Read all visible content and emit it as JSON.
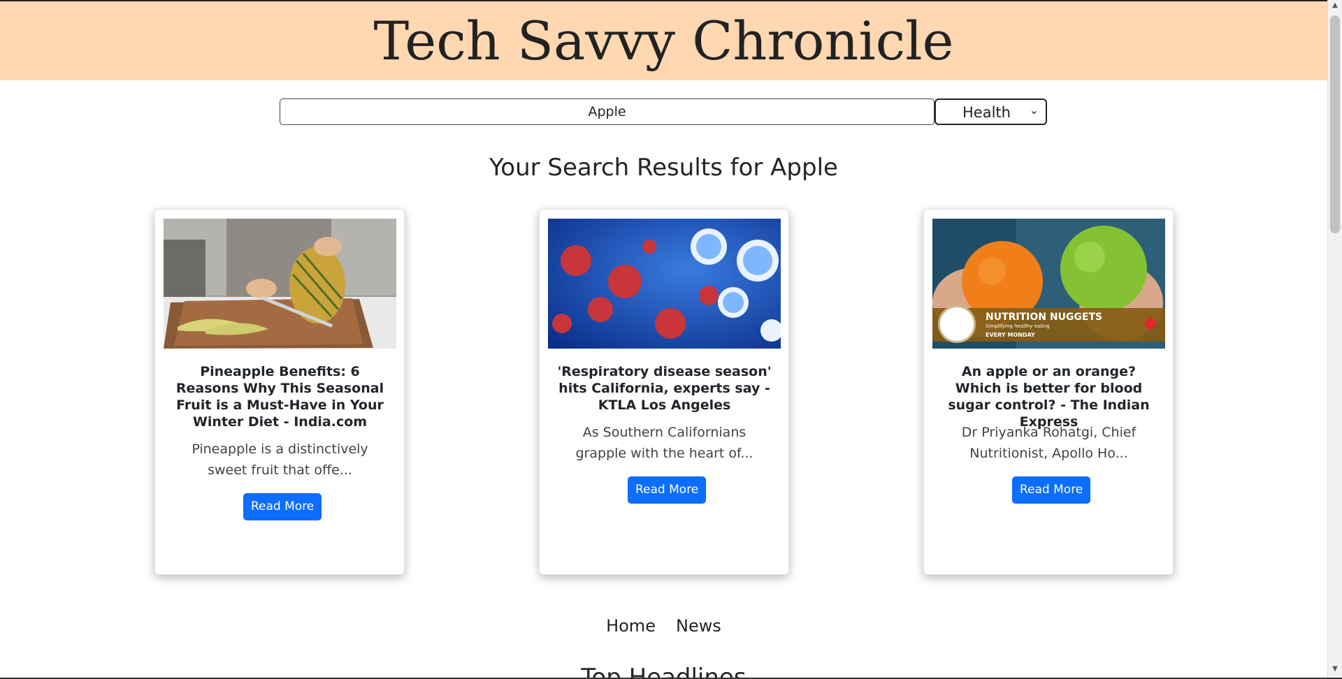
{
  "header": {
    "title": "Tech Savvy Chronicle"
  },
  "search": {
    "value": "Apple",
    "category_selected": "Health"
  },
  "results": {
    "heading": "Your Search Results for Apple",
    "cards": [
      {
        "title": "Pineapple Benefits: 6 Reasons Why This Seasonal Fruit is a Must-Have in Your Winter Diet - India.com",
        "description": "Pineapple is a distinctively sweet fruit that offe...",
        "button": "Read More",
        "image": "pineapple-cutting-photo"
      },
      {
        "title": "'Respiratory disease season' hits California, experts say - KTLA Los Angeles",
        "description": "As Southern Californians grapple with the heart of...",
        "button": "Read More",
        "image": "virus-particles-photo"
      },
      {
        "title": "An apple or an orange? Which is better for blood sugar control? - The Indian Express",
        "description": "Dr Priyanka Rohatgi, Chief Nutritionist, Apollo Ho...",
        "button": "Read More",
        "image": "orange-and-apple-photo",
        "image_banner": {
          "title": "NUTRITION NUGGETS",
          "subtitle": "Simplifying healthy eating",
          "tag": "EVERY MONDAY"
        }
      }
    ]
  },
  "nav": {
    "home": "Home",
    "news": "News"
  },
  "next_section": {
    "heading": "Top Headlines"
  },
  "colors": {
    "header_bg": "#ffd8b1",
    "button_bg": "#0d6efd"
  }
}
